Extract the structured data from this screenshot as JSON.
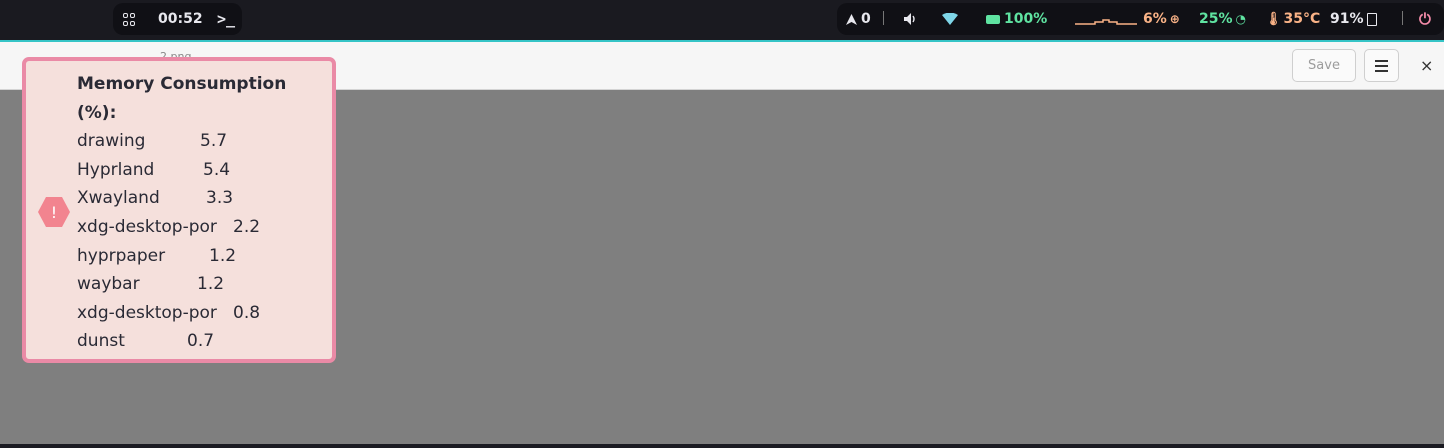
{
  "topbar": {
    "left": {
      "icon": "apps-grid-icon",
      "clock": "00:52",
      "terminal_icon": "terminal-icon"
    },
    "right": {
      "workspace_count": "0",
      "battery": "100%",
      "cpu": "6%",
      "gpu": "25%",
      "temperature": "35°C",
      "memory": "91%"
    }
  },
  "window": {
    "title": "2.png",
    "save_label": "Save",
    "close_label": "×"
  },
  "notification": {
    "title": "Memory Consumption (%):",
    "rows": [
      {
        "name": "drawing",
        "value": "5.7"
      },
      {
        "name": "Hyprland",
        "value": "5.4"
      },
      {
        "name": "Xwayland",
        "value": "3.3"
      },
      {
        "name": "xdg-desktop-por",
        "value": "2.2"
      },
      {
        "name": "hyprpaper",
        "value": "1.2"
      },
      {
        "name": "waybar",
        "value": "1.2"
      },
      {
        "name": "xdg-desktop-por",
        "value": "0.8"
      },
      {
        "name": "dunst",
        "value": "0.7"
      }
    ]
  },
  "colors": {
    "accent_teal": "#35c4c6",
    "battery_green": "#5fe3a1",
    "cpu_orange": "#fab387",
    "temp_orange": "#fab387",
    "power_red": "#f38ba8",
    "notif_border": "#ea8aa6",
    "notif_bg": "#f5e0dc"
  }
}
